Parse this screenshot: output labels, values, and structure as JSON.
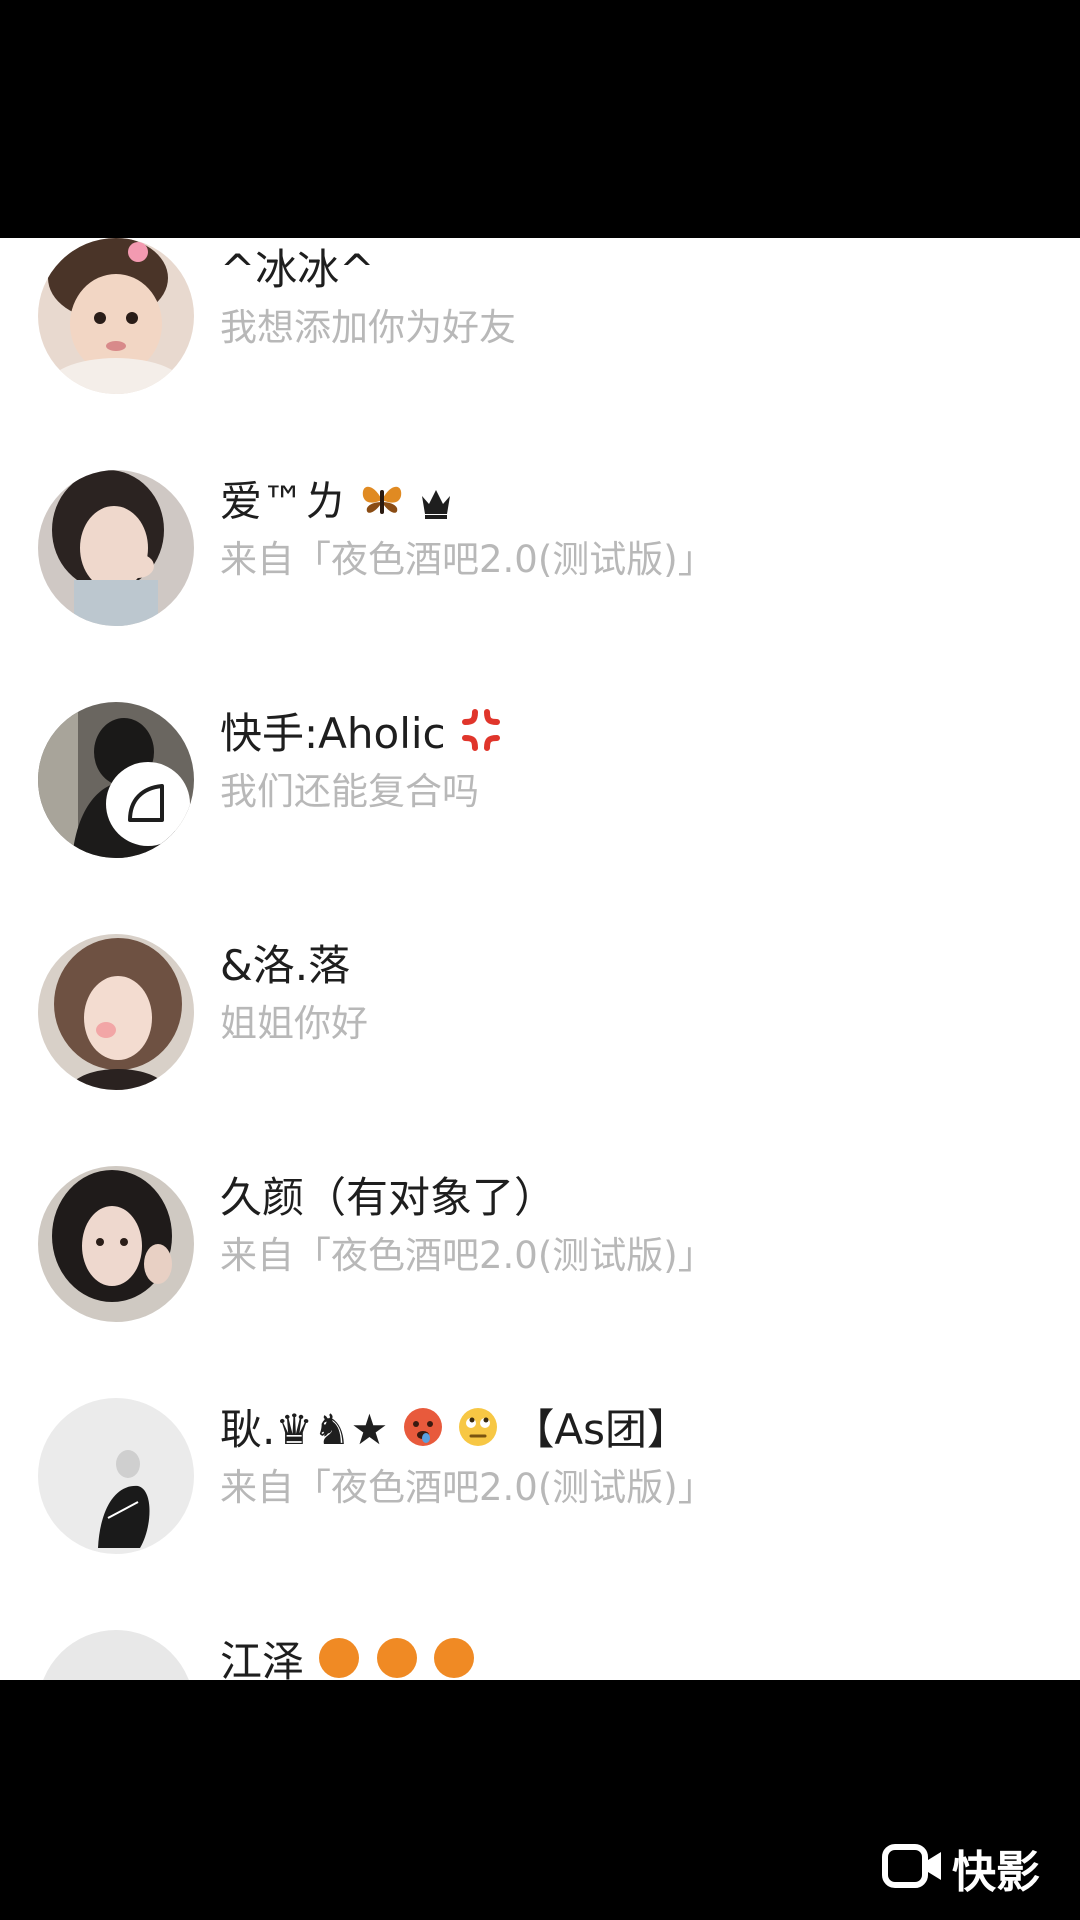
{
  "contacts": [
    {
      "name": "^冰冰^",
      "message": "我想添加你为好友"
    },
    {
      "name": "爱™ㄌ",
      "message": "来自「夜色酒吧2.0(测试版)」"
    },
    {
      "name": "快手:Aholic",
      "message": "我们还能复合吗"
    },
    {
      "name": "&洛.落",
      "message": "姐姐你好"
    },
    {
      "name": "久颜（有对象了）",
      "message": "来自「夜色酒吧2.0(测试版)」"
    },
    {
      "name": "耿.♛♞★",
      "suffix": "【As团】",
      "message": "来自「夜色酒吧2.0(测试版)」"
    },
    {
      "name": "江泽"
    }
  ],
  "watermark": {
    "label": "快影",
    "icon": "video-camera-icon"
  },
  "colors": {
    "name": "#1e1e1e",
    "message": "#b8b8b8",
    "background": "#ffffff",
    "letterbox": "#000000"
  }
}
